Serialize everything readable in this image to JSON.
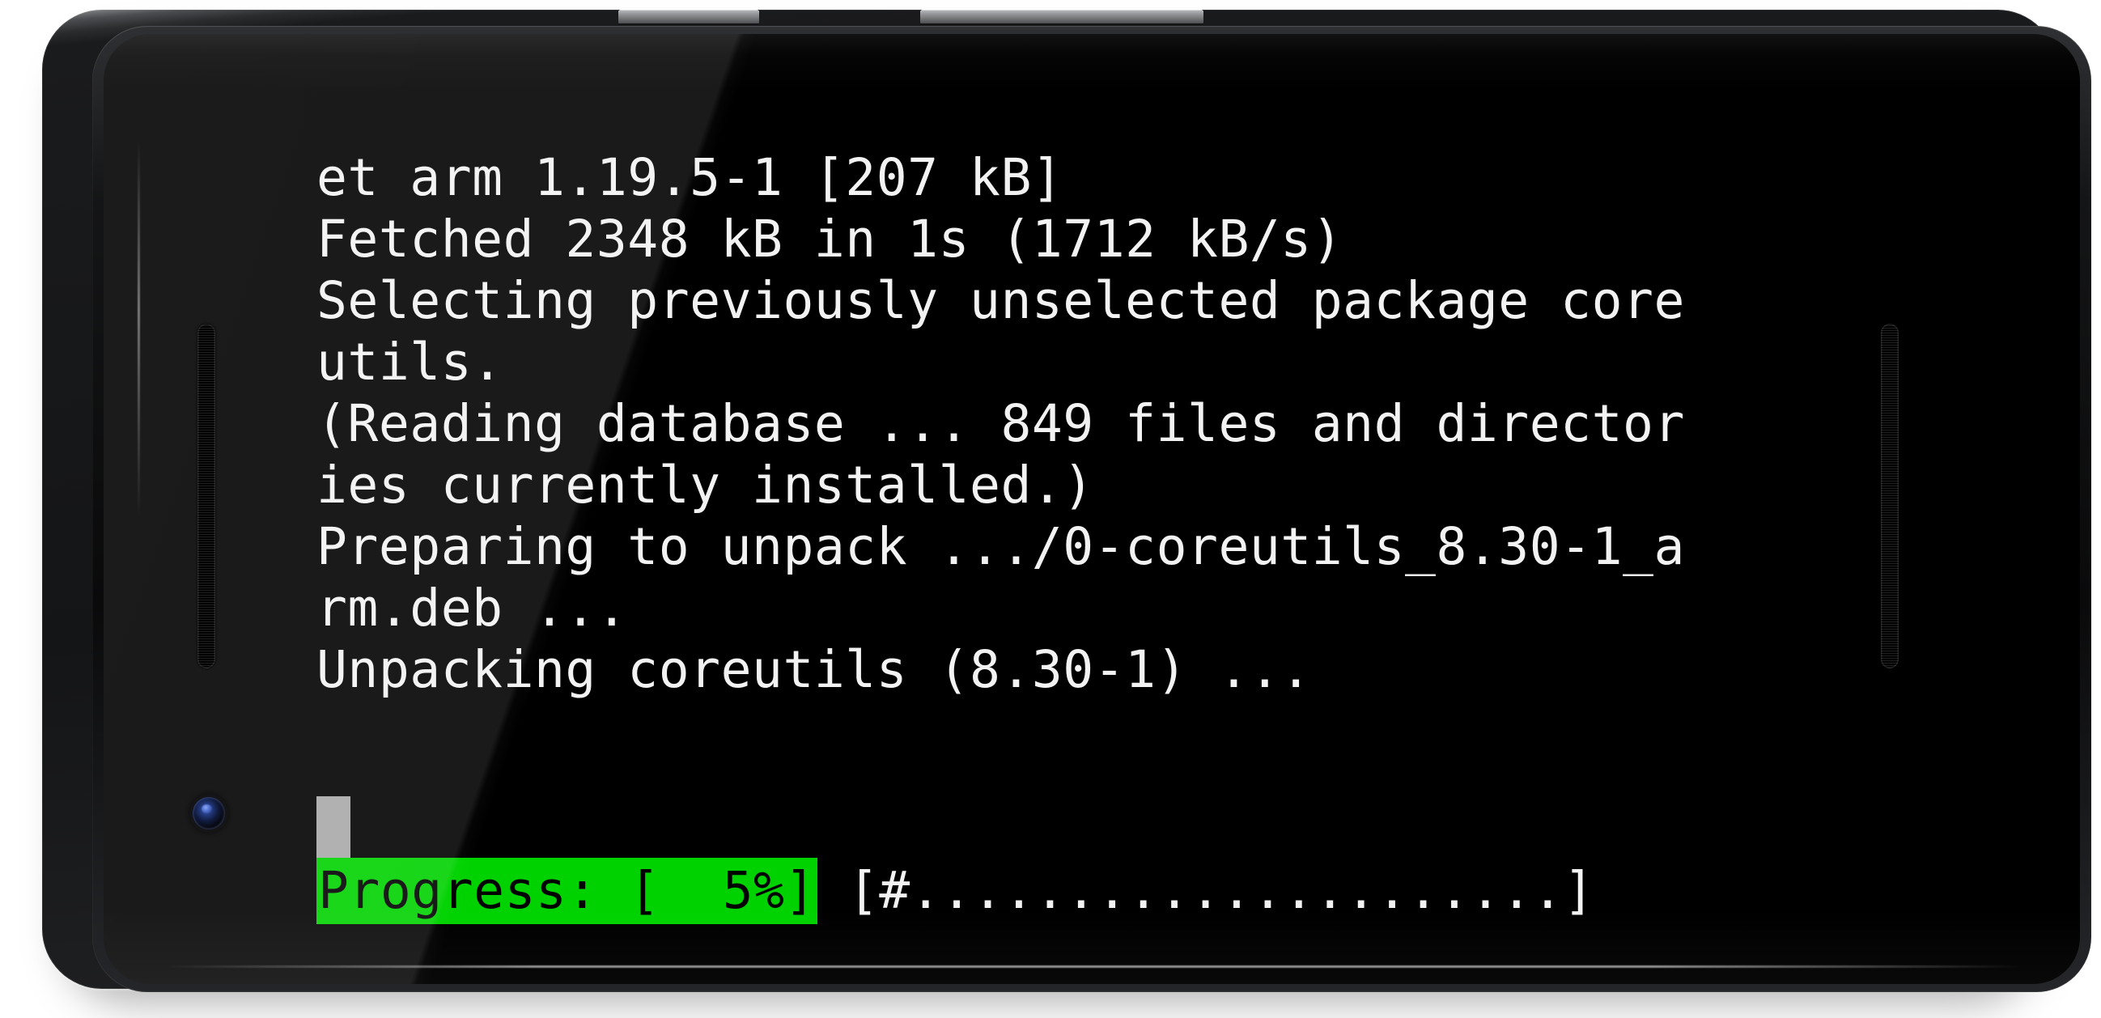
{
  "device": {
    "type": "smartphone",
    "orientation": "landscape",
    "frame_color": "#1a1b1d",
    "buttons": [
      {
        "name": "volume-rocker",
        "label": "Volume"
      },
      {
        "name": "power-button",
        "label": "Power"
      }
    ],
    "camera_label": "Front camera",
    "speaker_left_label": "Speaker grille left",
    "speaker_right_label": "Speaker grille right"
  },
  "terminal": {
    "background_color": "#000000",
    "foreground_color": "#f2f2f2",
    "lines": [
      "et arm 1.19.5-1 [207 kB]",
      "Fetched 2348 kB in 1s (1712 kB/s)",
      "Selecting previously unselected package core",
      "utils.",
      "(Reading database ... 849 files and director",
      "ies currently installed.)",
      "Preparing to unpack .../0-coreutils_8.30-1_a",
      "rm.deb ...",
      "Unpacking coreutils (8.30-1) ..."
    ],
    "cursor": {
      "name": "cursor-block",
      "color": "#a8a8a8"
    },
    "progress": {
      "highlight_text": "Progress: [  5%]",
      "highlight_background": "#00d200",
      "highlight_foreground": "#000000",
      "percent": 5,
      "bar_text": "[#.....................]",
      "bar_filled_char": "#",
      "bar_empty_char": ".",
      "bar_total_slots": 22,
      "bar_filled_slots": 1
    }
  }
}
